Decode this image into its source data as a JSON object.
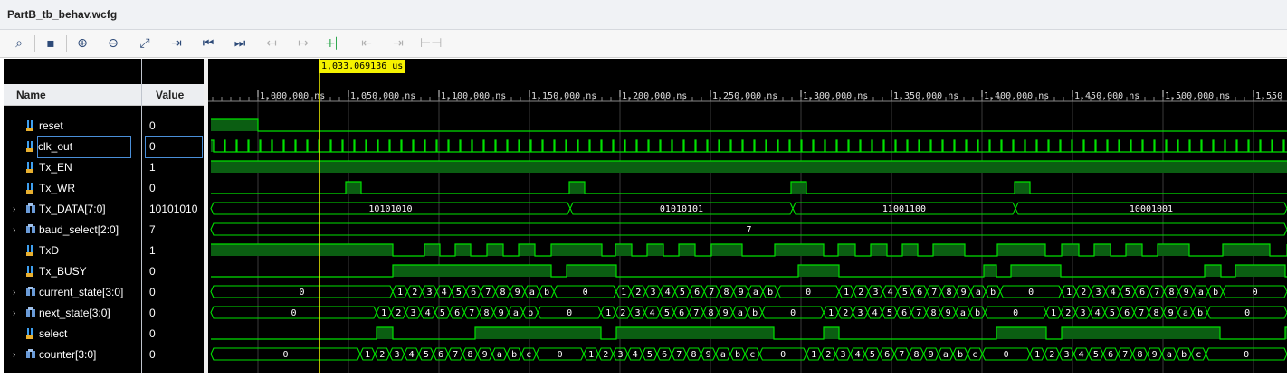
{
  "window": {
    "title": "PartB_tb_behav.wcfg"
  },
  "toolbar": {
    "buttons": [
      {
        "icon": "search-icon",
        "glyph": "🔍"
      },
      {
        "icon": "save-icon",
        "glyph": "💾"
      },
      {
        "icon": "zoom-in-icon",
        "glyph": "⊕"
      },
      {
        "icon": "zoom-out-icon",
        "glyph": "⊖"
      },
      {
        "icon": "zoom-fit-icon",
        "glyph": "⤧"
      },
      {
        "icon": "go-to-cursor-icon",
        "glyph": "⇥"
      },
      {
        "icon": "go-to-time-zero-icon",
        "glyph": "⏮"
      },
      {
        "icon": "go-to-last-time-icon",
        "glyph": "⏭"
      },
      {
        "icon": "previous-transition-icon",
        "glyph": "↤"
      },
      {
        "icon": "next-transition-icon",
        "glyph": "↦"
      },
      {
        "icon": "add-marker-icon",
        "glyph": "+⎸"
      },
      {
        "icon": "previous-marker-icon",
        "glyph": "⇤"
      },
      {
        "icon": "next-marker-icon",
        "glyph": "⇥"
      },
      {
        "icon": "swap-cursors-icon",
        "glyph": "⊢⊣"
      }
    ]
  },
  "columns": {
    "name": "Name",
    "value": "Value"
  },
  "cursor": {
    "time_label": "1,033.069136 us"
  },
  "time_ruler": [
    "1,000,000 ns",
    "1,050,000 ns",
    "1,100,000 ns",
    "1,150,000 ns",
    "1,200,000 ns",
    "1,250,000 ns",
    "1,300,000 ns",
    "1,350,000 ns",
    "1,400,000 ns",
    "1,450,000 ns",
    "1,500,000 ns",
    "1,550"
  ],
  "signals": [
    {
      "name": "reset",
      "value": "0",
      "type": "bit",
      "expandable": false
    },
    {
      "name": "clk_out",
      "value": "0",
      "type": "bit",
      "expandable": false
    },
    {
      "name": "Tx_EN",
      "value": "1",
      "type": "bit",
      "expandable": false
    },
    {
      "name": "Tx_WR",
      "value": "0",
      "type": "bit",
      "expandable": false
    },
    {
      "name": "Tx_DATA[7:0]",
      "value": "10101010",
      "type": "bus",
      "expandable": true
    },
    {
      "name": "baud_select[2:0]",
      "value": "7",
      "type": "bus",
      "expandable": true
    },
    {
      "name": "TxD",
      "value": "1",
      "type": "bit",
      "expandable": false
    },
    {
      "name": "Tx_BUSY",
      "value": "0",
      "type": "bit",
      "expandable": false
    },
    {
      "name": "current_state[3:0]",
      "value": "0",
      "type": "bus",
      "expandable": true
    },
    {
      "name": "next_state[3:0]",
      "value": "0",
      "type": "bus",
      "expandable": true
    },
    {
      "name": "select",
      "value": "0",
      "type": "bit",
      "expandable": false
    },
    {
      "name": "counter[3:0]",
      "value": "0",
      "type": "bus",
      "expandable": true
    }
  ],
  "bus_labels": {
    "tx_data": [
      "10101010",
      "01010101",
      "11001100",
      "10001001"
    ],
    "baud_select": "7",
    "state_sequence": [
      "1",
      "2",
      "3",
      "4",
      "5",
      "6",
      "7",
      "8",
      "9",
      "a",
      "b"
    ],
    "counter_sequence": [
      "1",
      "2",
      "3",
      "4",
      "5",
      "6",
      "7",
      "8",
      "9",
      "a",
      "b",
      "c"
    ],
    "idle": "0"
  },
  "colors": {
    "wave": "#00e000",
    "cursor": "#f5f200",
    "background": "#000000",
    "grid": "#3a3a3a"
  }
}
